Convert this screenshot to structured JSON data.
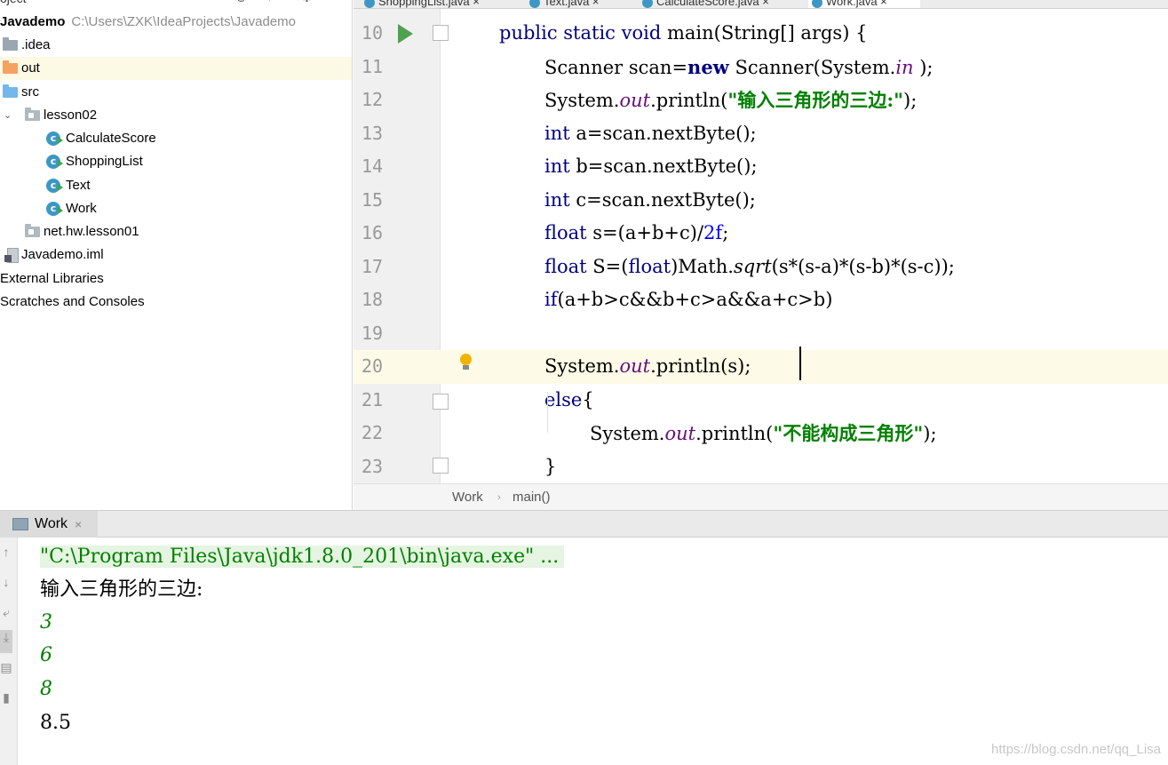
{
  "project": {
    "panel_title": "oject",
    "root": {
      "name": "Javademo",
      "path": "C:\\Users\\ZXK\\IdeaProjects\\Javademo"
    },
    "items": [
      {
        "label": ".idea",
        "icon": "folder-icon"
      },
      {
        "label": "out",
        "icon": "folder-orange-icon"
      },
      {
        "label": "src",
        "icon": "folder-source-icon"
      },
      {
        "label": "lesson02",
        "icon": "package-icon"
      },
      {
        "label": "CalculateScore",
        "icon": "java-class-icon"
      },
      {
        "label": "ShoppingList",
        "icon": "java-class-icon"
      },
      {
        "label": "Text",
        "icon": "java-class-icon"
      },
      {
        "label": "Work",
        "icon": "java-class-icon"
      },
      {
        "label": "net.hw.lesson01",
        "icon": "package-icon"
      },
      {
        "label": "Javademo.iml",
        "icon": "module-file-icon"
      },
      {
        "label": "External Libraries",
        "icon": ""
      },
      {
        "label": "Scratches and Consoles",
        "icon": ""
      }
    ]
  },
  "tabs": [
    {
      "label": "ShoppingList.java"
    },
    {
      "label": "Text.java"
    },
    {
      "label": "CalculateScore.java"
    },
    {
      "label": "Work.java",
      "active": true
    }
  ],
  "editor": {
    "lines": [
      {
        "num": "10"
      },
      {
        "num": "11"
      },
      {
        "num": "12"
      },
      {
        "num": "13"
      },
      {
        "num": "14"
      },
      {
        "num": "15"
      },
      {
        "num": "16"
      },
      {
        "num": "17"
      },
      {
        "num": "18"
      },
      {
        "num": "19"
      },
      {
        "num": "20"
      },
      {
        "num": "21"
      },
      {
        "num": "22"
      },
      {
        "num": "23"
      }
    ],
    "code": {
      "l10": {
        "a": "public static void",
        "b": " main(String[] args) {"
      },
      "l11": {
        "a": "Scanner scan=",
        "b": "new",
        "c": " Scanner(System.",
        "d": "in",
        "e": " );"
      },
      "l12": {
        "a": "System.",
        "b": "out",
        "c": ".println(",
        "d": "\"输入三角形的三边:\"",
        "e": ");"
      },
      "l13": {
        "a": "int",
        "b": " a=scan.nextByte();"
      },
      "l14": {
        "a": "int",
        "b": " b=scan.nextByte();"
      },
      "l15": {
        "a": "int",
        "b": " c=scan.nextByte();"
      },
      "l16": {
        "a": "float",
        "b": " s=(a+b+c)/",
        "c": "2f",
        "d": ";"
      },
      "l17": {
        "a": "float",
        "b": " S=(",
        "c": "float",
        "d": ")Math.",
        "e": "sqrt",
        "f": "(s*(s-a)*(s-b)*(s-c));"
      },
      "l18": {
        "a": "if",
        "b": "(a+b>c&&b+c>a&&a+c>b)"
      },
      "l20": {
        "a": "System.",
        "b": "out",
        "c": ".println(s);"
      },
      "l21": {
        "a": "else",
        "b": "{"
      },
      "l22": {
        "a": "System.",
        "b": "out",
        "c": ".println(",
        "d": "\"不能构成三角形\"",
        "e": ");"
      },
      "l23": {
        "a": "}"
      }
    }
  },
  "breadcrumb": {
    "class": "Work",
    "method": "main()"
  },
  "run": {
    "tab_label": "Work",
    "command": "\"C:\\Program Files\\Java\\jdk1.8.0_201\\bin\\java.exe\" ...",
    "prompt": "输入三角形的三边:",
    "inputs": [
      "3",
      "6",
      "8"
    ],
    "result": "8.5"
  },
  "watermark": "https://blog.csdn.net/qq_Lisa",
  "colors": {
    "keyword": "#000080",
    "string": "#008000",
    "field": "#660e7a",
    "number": "#0000ff",
    "current_line": "#fdfbe7",
    "run_icon": "#50a14f"
  }
}
